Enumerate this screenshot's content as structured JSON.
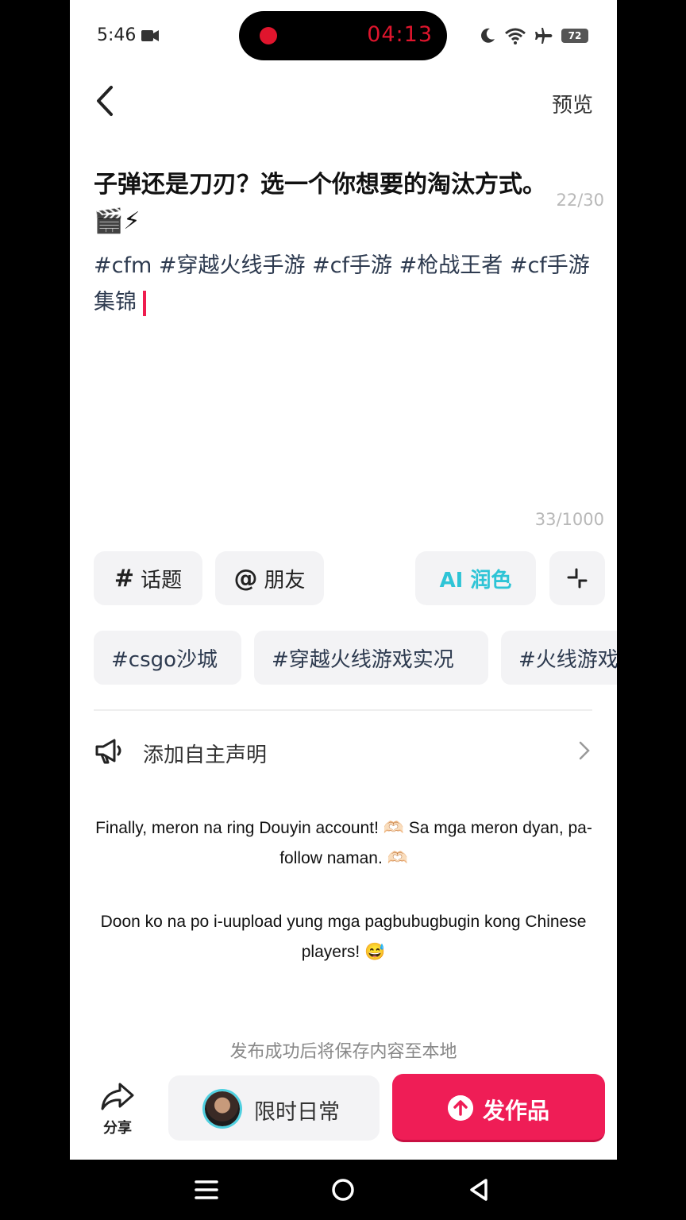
{
  "status_bar": {
    "time": "5:46",
    "recording_time": "04:13",
    "battery": "72"
  },
  "header": {
    "preview_label": "预览"
  },
  "post": {
    "title": "子弹还是刀刃？选一个你想要的淘汰方式。🎬⚡",
    "title_count": "22/30",
    "hashtags": "#cfm #穿越火线手游 #cf手游 #枪战王者 #cf手游集锦",
    "desc_count": "33/1000"
  },
  "toolbar": {
    "topic_symbol": "#",
    "topic_label": "话题",
    "friend_symbol": "@",
    "friend_label": "朋友",
    "ai_label": "AI 润色"
  },
  "suggested_tags": [
    "#csgo沙城",
    "#穿越火线游戏实况",
    "#火线游戏"
  ],
  "declaration": {
    "label": "添加自主声明"
  },
  "subtitles": {
    "line1": "Finally, meron na ring Douyin account! 🫶🏻 Sa mga meron dyan, pa-follow naman. 🫶🏻",
    "line2": "Doon ko na po i-uupload yung mga pagbubugbugin kong Chinese players! 😅"
  },
  "footer": {
    "save_note": "发布成功后将保存内容至本地",
    "share_label": "分享",
    "daily_label": "限时日常",
    "publish_label": "发作品"
  },
  "colors": {
    "accent": "#ef1d56",
    "ai_cyan": "#2ec4d6",
    "recording_red": "#e0152d"
  }
}
